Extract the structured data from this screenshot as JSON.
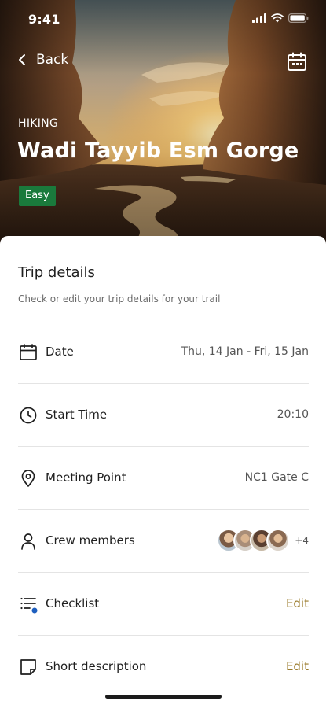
{
  "status_bar": {
    "time": "9:41"
  },
  "header": {
    "back_label": "Back",
    "calendar_icon": "calendar-icon"
  },
  "trail": {
    "category": "HIKING",
    "name": "Wadi Tayyib Esm Gorge",
    "difficulty": "Easy",
    "difficulty_color": "#1a7a3c"
  },
  "trip_details": {
    "title": "Trip details",
    "subtitle": "Check or edit your trip details for your trail",
    "rows": [
      {
        "icon": "calendar-icon",
        "label": "Date",
        "value": "Thu, 14 Jan - Fri, 15 Jan"
      },
      {
        "icon": "clock-icon",
        "label": "Start Time",
        "value": "20:10"
      },
      {
        "icon": "location-pin-icon",
        "label": "Meeting Point",
        "value": "NC1 Gate C"
      },
      {
        "icon": "person-icon",
        "label": "Crew members",
        "extra_count": "+4"
      },
      {
        "icon": "checklist-icon",
        "label": "Checklist",
        "action": "Edit"
      },
      {
        "icon": "note-icon",
        "label": "Short description",
        "action": "Edit"
      }
    ]
  },
  "colors": {
    "accent_edit": "#9a7a2a",
    "badge_green": "#1a7a3c",
    "notification_dot": "#1e5fbf"
  }
}
